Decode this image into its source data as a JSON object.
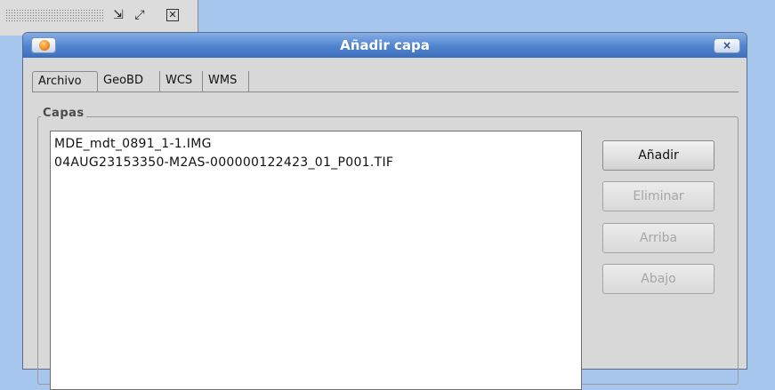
{
  "desktop": {
    "window_controls": [
      "↙↗",
      "⊠"
    ]
  },
  "dialog": {
    "title": "Añadir capa",
    "close_label": "×",
    "tabs": [
      {
        "label": "Archivo",
        "active": true
      },
      {
        "label": "GeoBD",
        "active": false
      },
      {
        "label": "WCS",
        "active": false
      },
      {
        "label": "WMS",
        "active": false
      }
    ],
    "group_title": "Capas",
    "layers": [
      "MDE_mdt_0891_1-1.IMG",
      "04AUG23153350-M2AS-000000122423_01_P001.TIF"
    ],
    "buttons": [
      {
        "label": "Añadir",
        "enabled": true
      },
      {
        "label": "Eliminar",
        "enabled": false
      },
      {
        "label": "Arriba",
        "enabled": false
      },
      {
        "label": "Abajo",
        "enabled": false
      }
    ]
  }
}
